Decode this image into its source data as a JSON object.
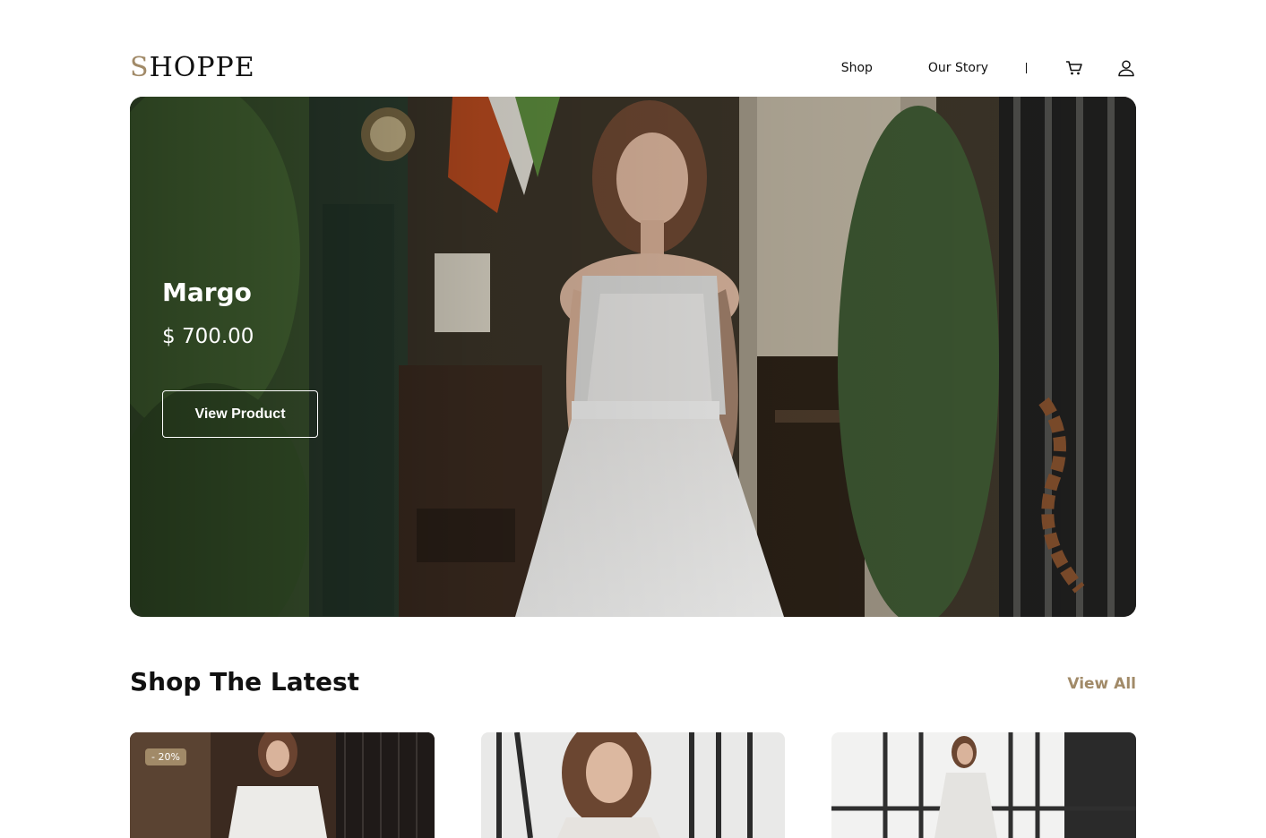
{
  "header": {
    "logo_first": "S",
    "logo_rest": "HOPPE",
    "nav": {
      "shop": "Shop",
      "story": "Our Story",
      "divider": "|"
    },
    "icons": [
      "cart-icon",
      "user-icon"
    ]
  },
  "hero": {
    "title": "Margo",
    "price": "$ 700.00",
    "button": "View Product"
  },
  "section": {
    "title": "Shop The Latest",
    "view_all": "View All"
  },
  "products": [
    {
      "badge": "- 20%"
    },
    {},
    {}
  ],
  "colors": {
    "accent": "#A18A68",
    "text": "#111111",
    "background": "#FFFFFF"
  }
}
